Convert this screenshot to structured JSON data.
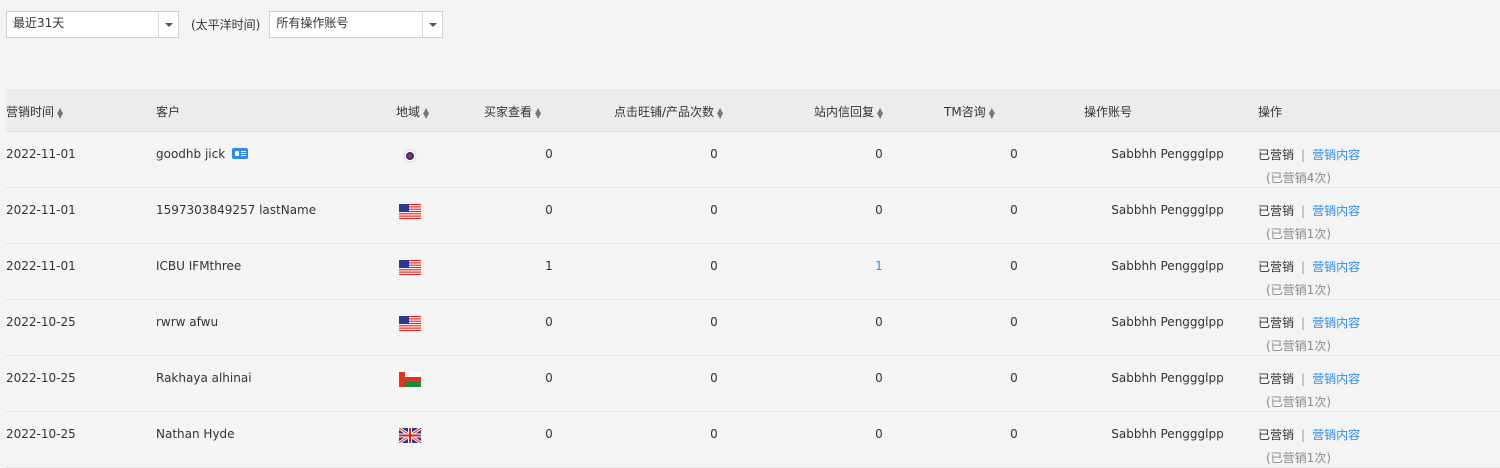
{
  "filters": {
    "date_range": "最近31天",
    "timezone": "(太平洋时间)",
    "account": "所有操作账号"
  },
  "table": {
    "headers": {
      "time": "营销时间",
      "customer": "客户",
      "region": "地域",
      "buyer_views": "买家查看",
      "clicks": "点击旺铺/产品次数",
      "replies": "站内信回复",
      "tm": "TM咨询",
      "account": "操作账号",
      "action": "操作"
    },
    "rows": [
      {
        "time": "2022-11-01",
        "customer": "goodhb jick",
        "has_card": true,
        "flag": "taiwan-flag-icon",
        "buyer_views": "0",
        "clicks": "0",
        "replies": "0",
        "tm": "0",
        "account": "Sabbhh Pengggl­pp",
        "status": "已营销",
        "content_link": "营销内容",
        "count_text": "(已营销4次)"
      },
      {
        "time": "2022-11-01",
        "customer": "1597303849257 lastName",
        "has_card": false,
        "flag": "usa-flag-icon",
        "buyer_views": "0",
        "clicks": "0",
        "replies": "0",
        "tm": "0",
        "account": "Sabbhh Penggglpp",
        "status": "已营销",
        "content_link": "营销内容",
        "count_text": "(已营销1次)"
      },
      {
        "time": "2022-11-01",
        "customer": "ICBU IFMthree",
        "has_card": false,
        "flag": "usa-flag-icon",
        "buyer_views": "1",
        "clicks": "0",
        "replies": "1",
        "tm": "0",
        "account": "Sabbhh Penggglpp",
        "status": "已营销",
        "content_link": "营销内容",
        "count_text": "(已营销1次)"
      },
      {
        "time": "2022-10-25",
        "customer": "rwrw afwu",
        "has_card": false,
        "flag": "usa-flag-icon",
        "buyer_views": "0",
        "clicks": "0",
        "replies": "0",
        "tm": "0",
        "account": "Sabbhh Penggglpp",
        "status": "已营销",
        "content_link": "营销内容",
        "count_text": "(已营销1次)"
      },
      {
        "time": "2022-10-25",
        "customer": "Rakhaya alhinai",
        "has_card": false,
        "flag": "oman-flag-icon",
        "buyer_views": "0",
        "clicks": "0",
        "replies": "0",
        "tm": "0",
        "account": "Sabbhh Penggglpp",
        "status": "已营销",
        "content_link": "营销内容",
        "count_text": "(已营销1次)"
      },
      {
        "time": "2022-10-25",
        "customer": "Nathan Hyde",
        "has_card": false,
        "flag": "uk-flag-icon",
        "buyer_views": "0",
        "clicks": "0",
        "replies": "0",
        "tm": "0",
        "account": "Sabbhh Penggglpp",
        "status": "已营销",
        "content_link": "营销内容",
        "count_text": "(已营销1次)"
      }
    ]
  },
  "colors": {
    "link": "#2e8bea",
    "reply_highlight": "#2e8bea"
  }
}
